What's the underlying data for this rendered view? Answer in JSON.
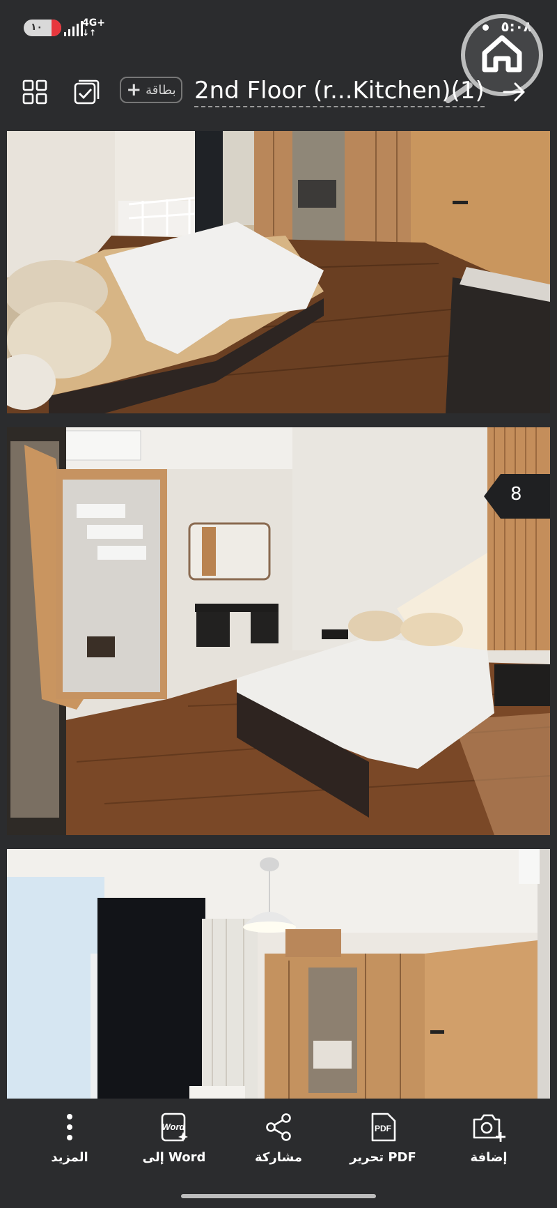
{
  "status_bar": {
    "battery": "١٠",
    "network": "4G+",
    "time": "٥:٠٨"
  },
  "toolbar": {
    "card_label": "بطاقة",
    "title": "2nd Floor (r...Kitchen)(1)"
  },
  "viewer": {
    "page_number": "8"
  },
  "bottom_bar": {
    "items": [
      {
        "label": "المزيد",
        "icon": "more-vertical-icon"
      },
      {
        "label": "إلى Word",
        "icon": "word-icon"
      },
      {
        "label": "مشاركة",
        "icon": "share-icon"
      },
      {
        "label": "تحرير PDF",
        "icon": "pdf-icon"
      },
      {
        "label": "إضافة",
        "icon": "camera-add-icon"
      }
    ],
    "word_badge": "Word",
    "pdf_badge": "PDF"
  },
  "colors": {
    "background": "#2b2c2e",
    "accent_battery": "#e8373d"
  }
}
